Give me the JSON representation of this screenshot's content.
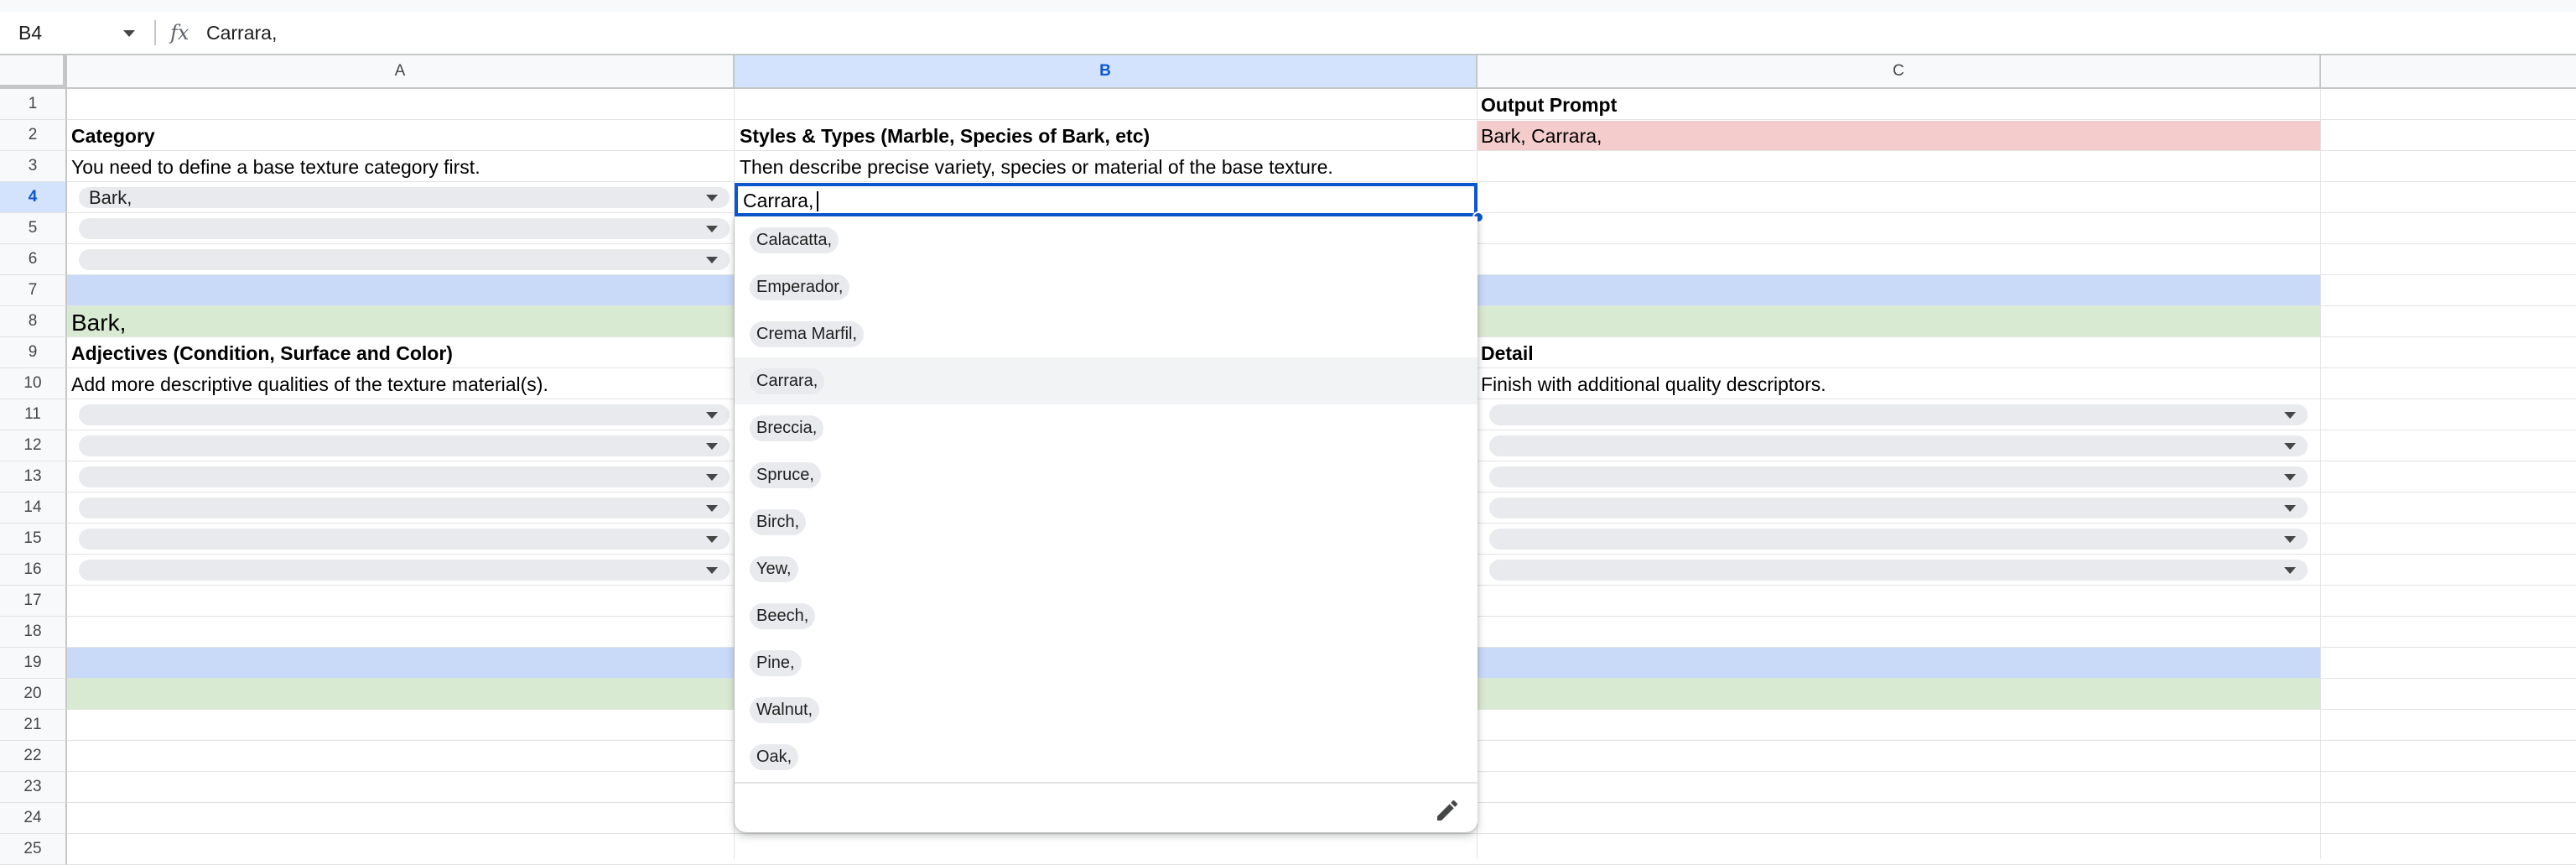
{
  "formula_bar": {
    "cell_ref": "B4",
    "fx_label": "fx",
    "value": "Carrara,"
  },
  "columns": [
    "A",
    "B",
    "C"
  ],
  "rows": [
    "1",
    "2",
    "3",
    "4",
    "5",
    "6",
    "7",
    "8",
    "9",
    "10",
    "11",
    "12",
    "13",
    "14",
    "15",
    "16",
    "17",
    "18",
    "19",
    "20",
    "21",
    "22",
    "23",
    "24",
    "25"
  ],
  "selected": {
    "column": "B",
    "row": "4"
  },
  "cells": {
    "C1": "Output Prompt",
    "A2": "Category",
    "B2": "Styles & Types (Marble, Species of Bark, etc)",
    "C2": "Bark, Carrara,",
    "A3": "You need to define a base texture category first.",
    "B3": "Then describe precise variety, species or material of the base texture.",
    "A4": "Bark,",
    "B4": "Carrara,",
    "A8": "Bark,",
    "A9": "Adjectives (Condition, Surface and Color)",
    "C9": "Detail",
    "A10": "Add more descriptive qualities of the texture material(s).",
    "C10": "Finish with additional quality descriptors."
  },
  "dropdown": {
    "options": [
      "Calacatta,",
      "Emperador,",
      "Crema Marfil,",
      "Carrara,",
      "Breccia,",
      "Spruce,",
      "Birch,",
      "Yew,",
      "Beech,",
      "Pine,",
      "Walnut,",
      "Oak,"
    ],
    "highlighted": "Carrara,",
    "edit_icon": "pencil-icon"
  },
  "colors": {
    "header_blue": "#c9daf8",
    "result_green": "#d9ead3",
    "output_red": "#f4cccc",
    "selection_blue": "#0b57d0"
  }
}
